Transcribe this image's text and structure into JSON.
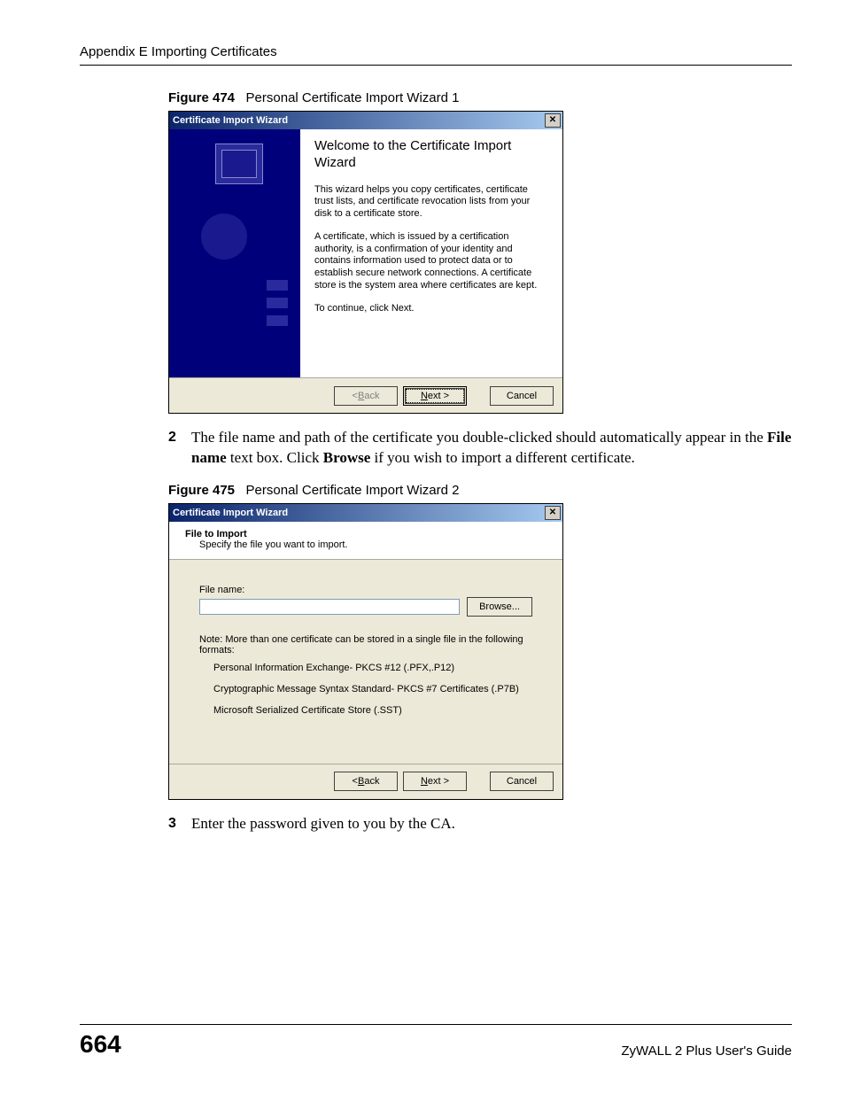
{
  "header": "Appendix E Importing Certificates",
  "fig474": {
    "label": "Figure 474",
    "caption": "Personal Certificate Import Wizard 1"
  },
  "wiz1": {
    "title": "Certificate Import Wizard",
    "heading": "Welcome to the Certificate Import Wizard",
    "p1": "This wizard helps you copy certificates, certificate trust lists, and certificate revocation lists from your disk to a certificate store.",
    "p2": "A certificate, which is issued by a certification authority, is a confirmation of your identity and contains information used to protect data or to establish secure network connections. A certificate store is the system area where certificates are kept.",
    "p3": "To continue, click Next.",
    "back_pre": "< ",
    "back_u": "B",
    "back_post": "ack",
    "next_u": "N",
    "next_post": "ext >",
    "cancel": "Cancel"
  },
  "step2": {
    "num": "2",
    "t1": "The file name and path of the certificate you double-clicked should automatically appear in the ",
    "b1": "File name",
    "t2": " text box. Click ",
    "b2": "Browse",
    "t3": " if you wish to import a different certificate."
  },
  "fig475": {
    "label": "Figure 475",
    "caption": "Personal Certificate Import Wizard 2"
  },
  "wiz2": {
    "title": "Certificate Import Wizard",
    "head1": "File to Import",
    "head2": "Specify the file you want to import.",
    "file_label_u": "F",
    "file_label_post": "ile name:",
    "browse_u": "r",
    "browse_pre": "B",
    "browse_post": "owse...",
    "note": "Note:  More than one certificate can be stored in a single file in the following formats:",
    "f1": "Personal Information Exchange- PKCS #12 (.PFX,.P12)",
    "f2": "Cryptographic Message Syntax Standard- PKCS #7 Certificates (.P7B)",
    "f3": "Microsoft Serialized Certificate Store (.SST)",
    "back_pre": "< ",
    "back_u": "B",
    "back_post": "ack",
    "next_u": "N",
    "next_post": "ext >",
    "cancel": "Cancel"
  },
  "step3": {
    "num": "3",
    "t1": "Enter the password given to you by the CA."
  },
  "footer": {
    "page": "664",
    "guide": "ZyWALL 2 Plus User's Guide"
  }
}
